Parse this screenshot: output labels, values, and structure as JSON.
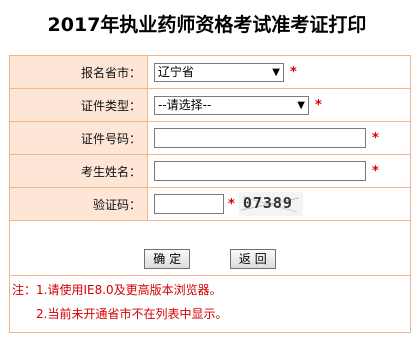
{
  "page_title": "2017年执业药师资格考试准考证打印",
  "form": {
    "province": {
      "label": "报名省市：",
      "value": "辽宁省"
    },
    "id_type": {
      "label": "证件类型：",
      "value": "--请选择--"
    },
    "id_number": {
      "label": "证件号码：",
      "value": ""
    },
    "name": {
      "label": "考生姓名：",
      "value": ""
    },
    "captcha": {
      "label": "验证码：",
      "value": "",
      "image_text": "07389"
    },
    "required_mark": "*"
  },
  "buttons": {
    "confirm": "确 定",
    "back": "返 回"
  },
  "notes": {
    "line1": "注：1.请使用IE8.0及更高版本浏览器。",
    "line2": "2.当前未开通省市不在列表中显示。"
  },
  "colors": {
    "label_bg": "#fde6d6",
    "border": "#f5b58a",
    "required": "#e00000",
    "note_text": "#d40000"
  }
}
